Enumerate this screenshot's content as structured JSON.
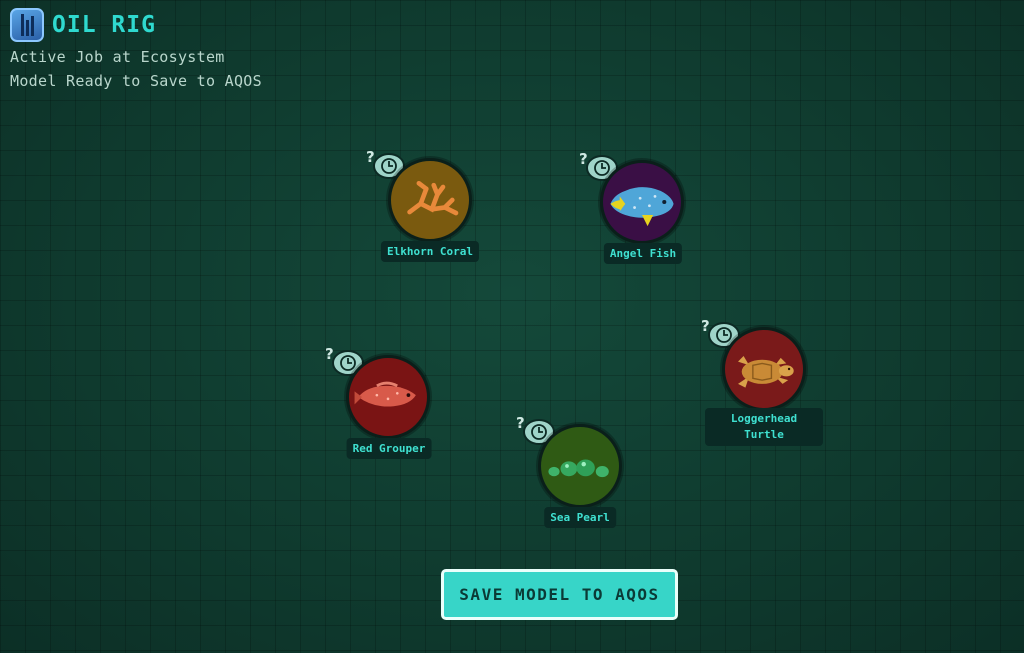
{
  "header": {
    "title": "OIL RIG",
    "line1": "Active Job at Ecosystem",
    "line2": "Model Ready to Save to AQOS"
  },
  "species": [
    {
      "id": "elkhorn-coral",
      "label": "Elkhorn Coral",
      "color": "#7a5a0f",
      "icon": "elkhorn-coral-icon"
    },
    {
      "id": "angel-fish",
      "label": "Angel Fish",
      "color": "#3a0f45",
      "icon": "angel-fish-icon"
    },
    {
      "id": "red-grouper",
      "label": "Red Grouper",
      "color": "#7a1414",
      "icon": "red-grouper-icon"
    },
    {
      "id": "sea-pearl",
      "label": "Sea Pearl",
      "color": "#2f5a14",
      "icon": "sea-pearl-icon"
    },
    {
      "id": "loggerhead-turtle",
      "label": "Loggerhead Turtle",
      "color": "#7a1a1a",
      "icon": "loggerhead-turtle-icon"
    }
  ],
  "save_button": {
    "label": "SAVE MODEL TO AQOS"
  },
  "colors": {
    "accent": "#37d5c8",
    "title": "#2fd9cf",
    "background": "#0f3a2e"
  }
}
